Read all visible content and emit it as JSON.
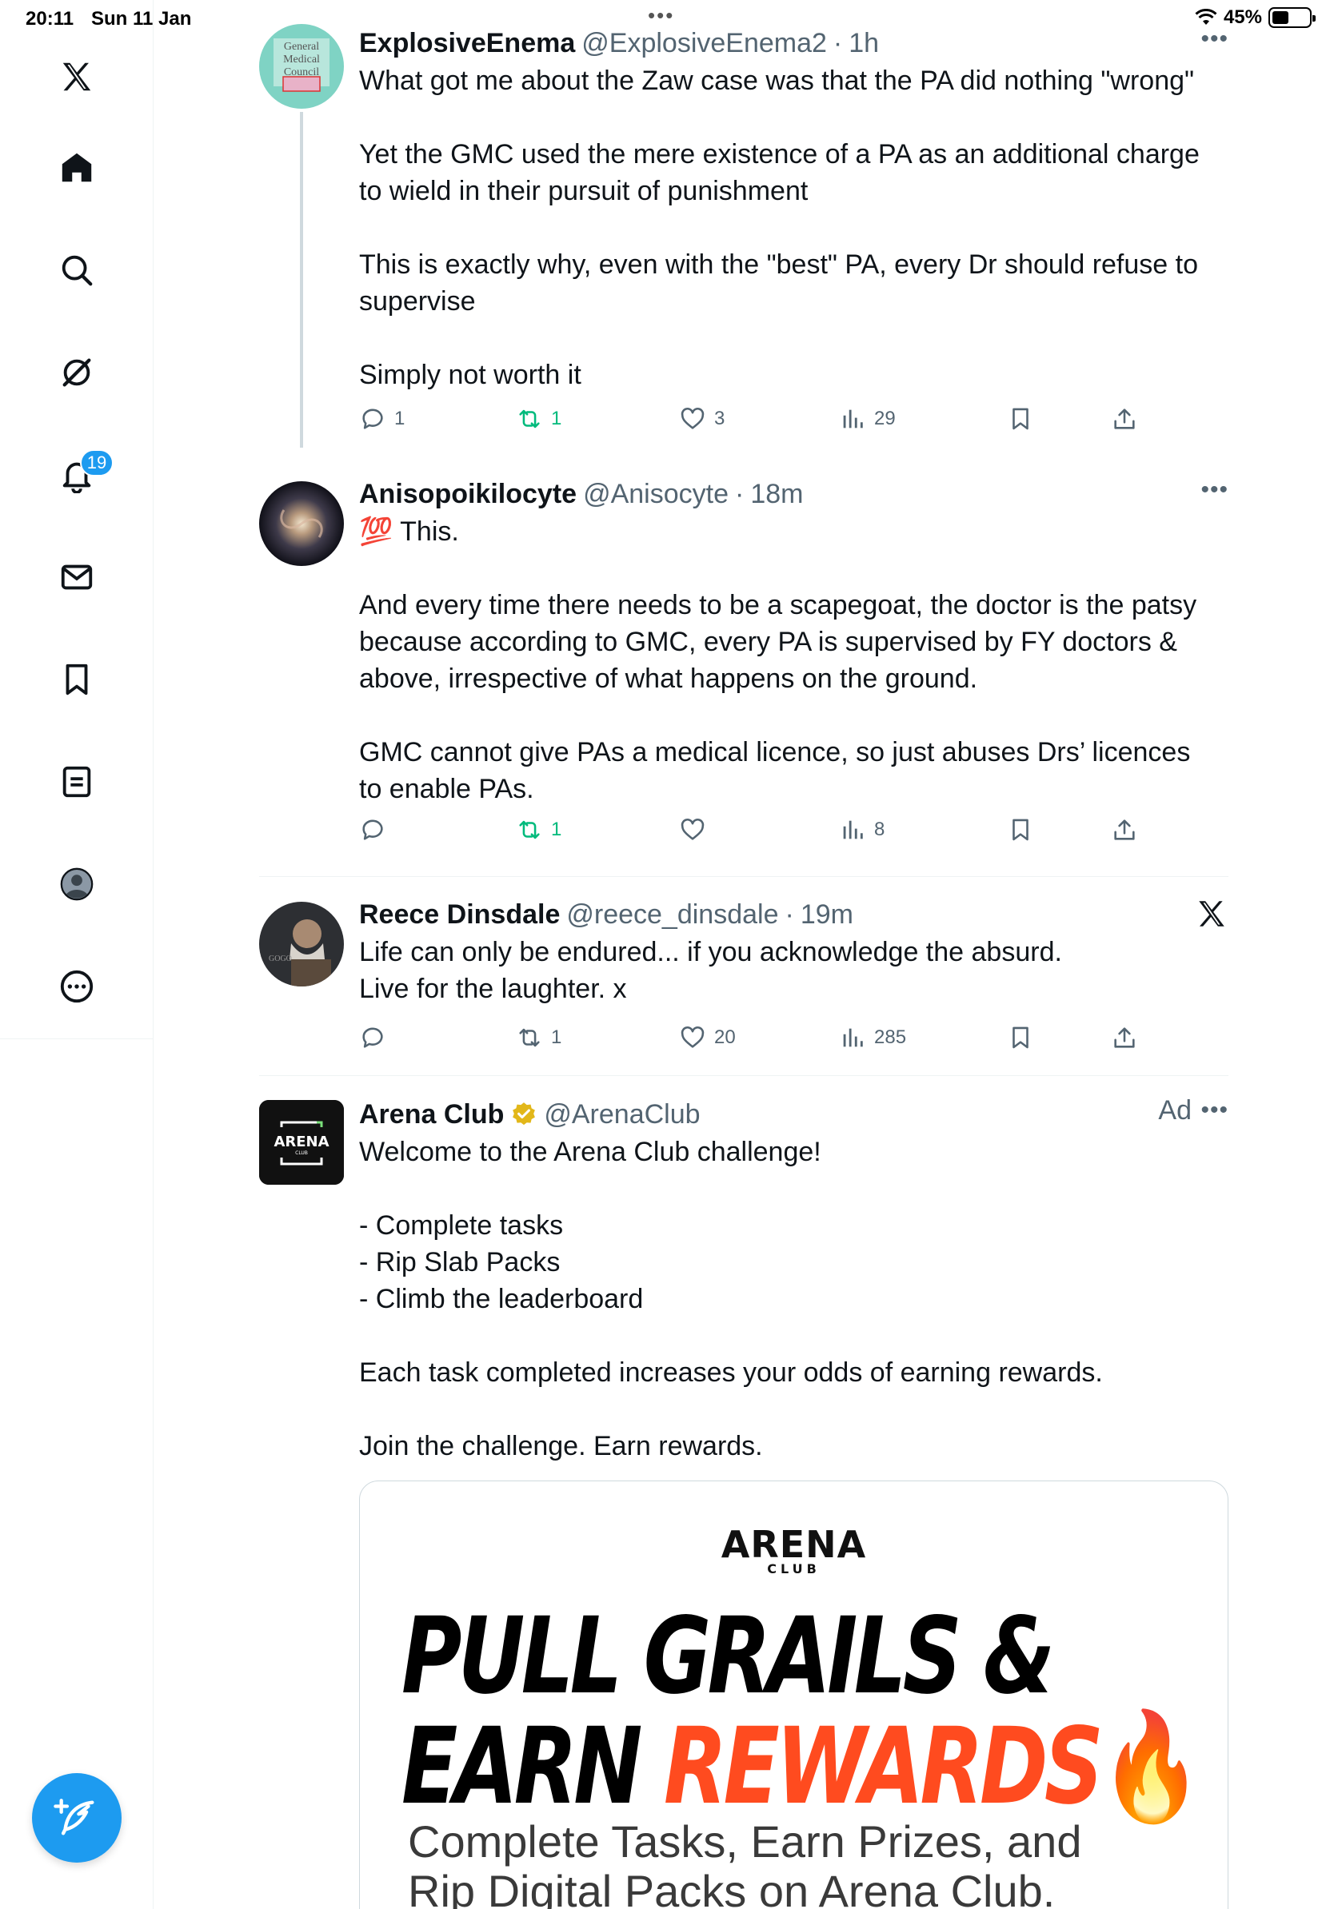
{
  "status_bar": {
    "time": "20:11",
    "date": "Sun 11 Jan",
    "battery_percent": "45%",
    "battery_level": 0.45
  },
  "sidebar": {
    "items": [
      {
        "icon": "x-logo-icon"
      },
      {
        "icon": "home-icon"
      },
      {
        "icon": "search-icon"
      },
      {
        "icon": "grok-icon"
      },
      {
        "icon": "notifications-icon",
        "badge": "19"
      },
      {
        "icon": "messages-icon"
      },
      {
        "icon": "bookmarks-icon"
      },
      {
        "icon": "lists-icon"
      },
      {
        "icon": "profile-icon"
      },
      {
        "icon": "more-icon"
      }
    ],
    "compose_icon": "compose-icon"
  },
  "feed": {
    "tweets": [
      {
        "display_name": "ExplosiveEnema",
        "handle": "@ExplosiveEnema2",
        "separator": "·",
        "time": "1h",
        "paragraphs": [
          "What got me about the Zaw case was that the PA did nothing \"wrong\"",
          "",
          "Yet the GMC used the mere existence of a PA as an additional charge to wield in their pursuit of punishment",
          "",
          "This is exactly why, even with the \"best\" PA, every Dr should refuse to supervise",
          "",
          "Simply not worth it"
        ],
        "replies": "1",
        "reposts": "1",
        "likes": "3",
        "views": "29"
      },
      {
        "display_name": "Anisopoikilocyte",
        "handle": "@Anisocyte",
        "separator": "·",
        "time": "18m",
        "paragraphs": [
          "💯 This.",
          "",
          "And every time there needs to be a scapegoat, the doctor is the patsy because according to GMC, every PA is supervised by FY doctors & above, irrespective of what happens on the ground.",
          "",
          "GMC cannot give PAs a medical licence, so just abuses Drs’ licences to enable PAs."
        ],
        "replies": "",
        "reposts": "1",
        "likes": "",
        "views": "8"
      },
      {
        "display_name": "Reece Dinsdale",
        "handle": "@reece_dinsdale",
        "separator": "·",
        "time": "19m",
        "paragraphs": [
          "Life can only be endured... if you acknowledge the absurd.",
          "Live for the laughter. x"
        ],
        "replies": "",
        "reposts": "1",
        "likes": "20",
        "views": "285"
      },
      {
        "display_name": "Arena Club",
        "handle": "@ArenaClub",
        "ad_label": "Ad",
        "paragraphs": [
          "Welcome to the Arena Club challenge!",
          "",
          "- Complete tasks",
          "- Rip Slab Packs",
          "- Climb the leaderboard",
          "",
          "Each task completed increases your odds of earning rewards.",
          "",
          "Join the challenge. Earn rewards."
        ],
        "card": {
          "logo": "ARENA",
          "logo_sub": "CLUB",
          "headline_line1": "PULL GRAILS &",
          "headline_line2_a": "EARN ",
          "headline_line2_b": "REWARDS",
          "headline_emoji": "🔥",
          "subline1": "Complete Tasks, Earn Prizes, and",
          "subline2": "Rip Digital Packs on Arena Club."
        }
      }
    ]
  },
  "colors": {
    "accent": "#1d9bf0",
    "repost_green": "#00ba7c",
    "muted": "#536471",
    "verified_gold": "#e2b719",
    "ad_orange": "#ff4b1f"
  }
}
